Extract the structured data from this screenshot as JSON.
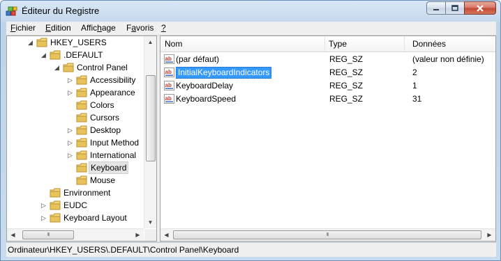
{
  "window": {
    "title": "Éditeur du Registre"
  },
  "menu": [
    {
      "label": "Fichier",
      "u": "F",
      "rest": "ichier"
    },
    {
      "label": "Edition",
      "u": "E",
      "rest": "dition"
    },
    {
      "label": "Affichage",
      "pre": "Affic",
      "u": "h",
      "rest": "age"
    },
    {
      "label": "Favoris",
      "pre": "F",
      "u": "a",
      "rest": "voris"
    },
    {
      "label": "?",
      "u": "?",
      "rest": ""
    }
  ],
  "tree": {
    "items": [
      {
        "label": "HKEY_USERS",
        "expander": "◢"
      },
      {
        "label": ".DEFAULT",
        "expander": "◢"
      },
      {
        "label": "Control Panel",
        "expander": "◢"
      },
      {
        "label": "Accessibility",
        "expander": "▷"
      },
      {
        "label": "Appearance",
        "expander": "▷"
      },
      {
        "label": "Colors",
        "expander": ""
      },
      {
        "label": "Cursors",
        "expander": ""
      },
      {
        "label": "Desktop",
        "expander": "▷"
      },
      {
        "label": "Input Method",
        "expander": "▷"
      },
      {
        "label": "International",
        "expander": "▷"
      },
      {
        "label": "Keyboard",
        "expander": "",
        "selected": true
      },
      {
        "label": "Mouse",
        "expander": ""
      },
      {
        "label": "Environment",
        "expander": ""
      },
      {
        "label": "EUDC",
        "expander": "▷"
      },
      {
        "label": "Keyboard Layout",
        "expander": "▷"
      }
    ]
  },
  "list": {
    "columns": [
      "Nom",
      "Type",
      "Données"
    ],
    "rows": [
      {
        "name": "(par défaut)",
        "type": "REG_SZ",
        "data": "(valeur non définie)"
      },
      {
        "name": "InitialKeyboardIndicators",
        "type": "REG_SZ",
        "data": "2",
        "selected": true
      },
      {
        "name": "KeyboardDelay",
        "type": "REG_SZ",
        "data": "1"
      },
      {
        "name": "KeyboardSpeed",
        "type": "REG_SZ",
        "data": "31"
      }
    ]
  },
  "status": {
    "path": "Ordinateur\\HKEY_USERS\\.DEFAULT\\Control Panel\\Keyboard"
  },
  "icons": {
    "app": "registry-editor-icon",
    "folder": "folder-icon",
    "value": "string-value-icon",
    "minimize": "minimize-icon",
    "maximize": "maximize-icon",
    "close": "close-icon"
  },
  "colors": {
    "selection": "#3399ff",
    "folder": "#e8c25a",
    "title_bar": "#c7daee"
  }
}
